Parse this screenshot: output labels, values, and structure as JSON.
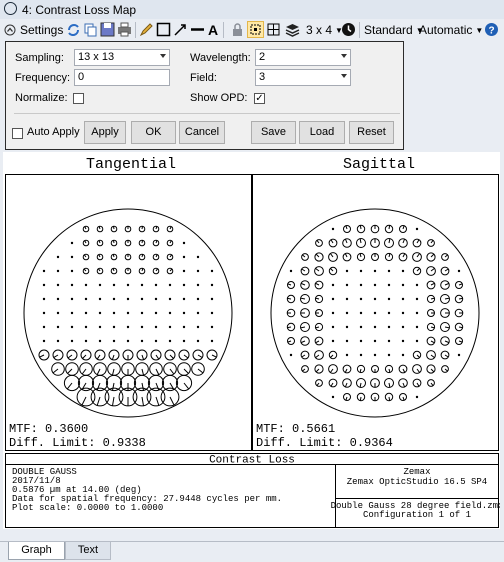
{
  "window": {
    "title": "4: Contrast Loss Map"
  },
  "toolbar": {
    "settings_label": "Settings",
    "layout_label": "3 x 4",
    "standard_label": "Standard",
    "automatic_label": "Automatic",
    "icons": [
      "refresh-icon",
      "copy-icon",
      "save-icon",
      "print-icon",
      "pencil-icon",
      "rectangle-icon",
      "arrow-icon",
      "line-icon",
      "text-icon",
      "lock-icon",
      "fit-icon",
      "layers-icon",
      "grid-layout-icon",
      "clock-icon",
      "help-icon"
    ]
  },
  "settings": {
    "sampling_label": "Sampling:",
    "sampling_value": "13 x 13",
    "frequency_label": "Frequency:",
    "frequency_value": "0",
    "normalize_label": "Normalize:",
    "wavelength_label": "Wavelength:",
    "wavelength_value": "2",
    "field_label": "Field:",
    "field_value": "3",
    "show_opd_label": "Show OPD:",
    "show_opd_checked": "✓",
    "auto_apply_label": "Auto Apply",
    "apply_label": "Apply",
    "ok_label": "OK",
    "cancel_label": "Cancel",
    "save_label": "Save",
    "load_label": "Load",
    "reset_label": "Reset"
  },
  "plot": {
    "tangential": {
      "title": "Tangential",
      "mtf_label": "MTF: 0.3600",
      "diff_label": "Diff. Limit: 0.9338"
    },
    "sagittal": {
      "title": "Sagittal",
      "mtf_label": "MTF: 0.5661",
      "diff_label": "Diff. Limit: 0.9364"
    },
    "legend_title": "Contrast Loss",
    "info_lines": [
      "DOUBLE GAUSS",
      "2017/11/8",
      "0.5876 µm at 14.00 (deg)",
      "Data for spatial frequency: 27.9448 cycles per mm.",
      "Plot scale: 0.0000 to 1.0000"
    ],
    "company": "Zemax",
    "product": "Zemax OpticStudio 16.5 SP4",
    "file": "Double Gauss 28 degree field.zmx",
    "config": "Configuration 1 of 1"
  },
  "tabs": [
    "Graph",
    "Text"
  ],
  "colors": {
    "accent": "#2b5f9e",
    "panel": "#f0f0f0",
    "chrome": "#e9edf3"
  }
}
